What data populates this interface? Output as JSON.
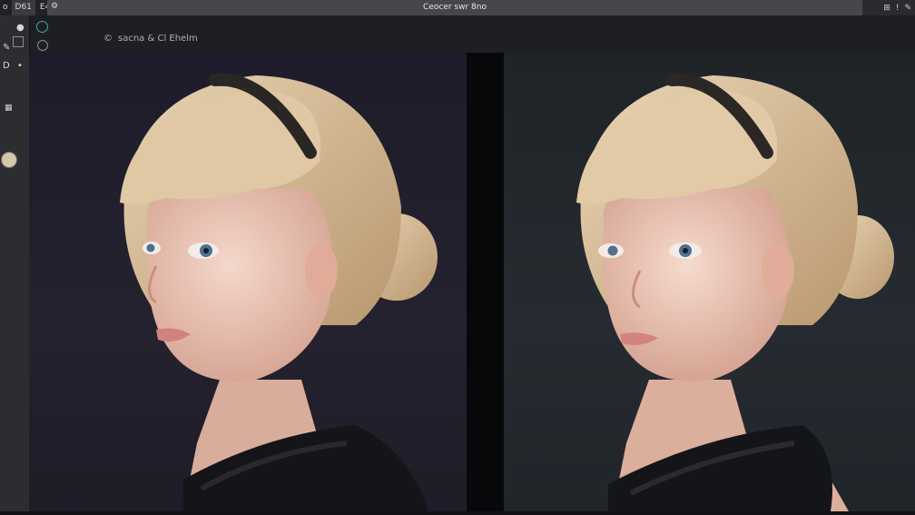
{
  "top_tabs": [
    {
      "label": "o"
    },
    {
      "label": "D61"
    },
    {
      "label": "E43"
    }
  ],
  "title": {
    "text": "Ceocer swr 8no",
    "gear_icon": "gear-icon"
  },
  "top_right": {
    "icons": [
      {
        "name": "grid-icon",
        "glyph": "⊞"
      },
      {
        "name": "info-icon",
        "glyph": "!"
      },
      {
        "name": "pen-icon",
        "glyph": "✎"
      }
    ]
  },
  "subbar": {
    "label_lead": "©",
    "label_text": "sacna & Cl Ehelm"
  },
  "toolbar": {
    "tools": [
      {
        "name": "brush-tool-icon",
        "glyph": "✎"
      },
      {
        "name": "fill-tool-icon",
        "glyph": "●"
      },
      {
        "name": "type-tool-icon",
        "glyph": "D"
      },
      {
        "name": "dot-tool-icon",
        "glyph": "•"
      }
    ],
    "grid_label": "▦"
  },
  "colors": {
    "accent": "#3fae95",
    "swatch": "#d9c6ae",
    "hair": "#d8bf9a",
    "skin": "#f0cfc0"
  }
}
